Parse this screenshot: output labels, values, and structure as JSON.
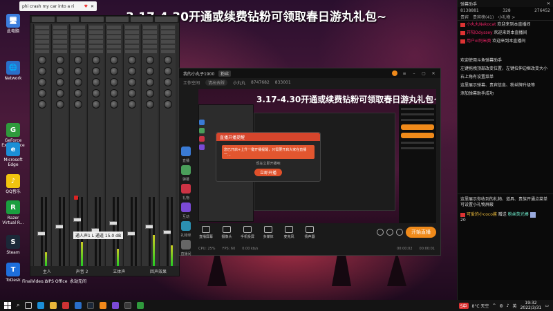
{
  "headline": "3.17-4.30开通或续费钻粉可领取春日游丸礼包~",
  "mini_tab": {
    "text": "phi crash my car into a ri",
    "heart_icon": "♥",
    "close_icon": "✕"
  },
  "desktop_icons": [
    {
      "label": "此电脑",
      "color": "#3b7ddd",
      "glyph": "🖥"
    },
    {
      "label": "Network",
      "color": "#2a6fc9",
      "glyph": "🌐"
    },
    {
      "label": "GeForce Experience",
      "color": "#2f9a3c",
      "glyph": "G"
    },
    {
      "label": "Microsoft Edge",
      "color": "#1b8fd6",
      "glyph": "e"
    },
    {
      "label": "QQ音乐",
      "color": "#f1c40f",
      "glyph": "♪"
    },
    {
      "label": "Razer Virtual R...",
      "color": "#1a9e3f",
      "glyph": "R"
    },
    {
      "label": "Steam",
      "color": "#1b2838",
      "glyph": "S"
    },
    {
      "label": "ToDesk",
      "color": "#1e6fdc",
      "glyph": "T"
    }
  ],
  "bottom_icons": [
    {
      "label": "FinalVideo..."
    },
    {
      "label": "WPS Office"
    },
    {
      "label": "永劫无间"
    }
  ],
  "mixer": {
    "label_box": "通人声1 L 通道  15.0 dB",
    "footer": [
      "主人",
      "声音 2",
      "立体声",
      "回声效果"
    ]
  },
  "stream_app": {
    "title": "我的小丸子1900",
    "tag": "粉丝",
    "sub_left": "工作空间",
    "sub_mid": "请出去踩",
    "sub_right": "小丸丸",
    "viewers": "8747682",
    "fans": "833001",
    "side_tools": [
      {
        "label": "直播",
        "color": "#3a7bd5"
      },
      {
        "label": "弹幕",
        "color": "#4a9f5a"
      },
      {
        "label": "礼物",
        "color": "#c34"
      },
      {
        "label": "互动",
        "color": "#7a4ad5"
      },
      {
        "label": "礼物单",
        "color": "#2b8fb0"
      },
      {
        "label": "直播间",
        "color": "#666"
      }
    ],
    "controls": [
      "直播屏幕",
      "摄像头",
      "手机投屏",
      "多媒体",
      "麦克风",
      "扬声器"
    ],
    "go_live": "开始直播",
    "status": {
      "bitrate": "CPU: 25%",
      "fps": "FPS: 60",
      "net": "0.00 kb/s",
      "time1": "00:00:02",
      "time2": "00:00:01"
    }
  },
  "popup": {
    "title": "直播开播提醒",
    "body": "您已开启+上升一键开播提醒，只需要开启大家在直播一...",
    "sub": "现在立即开播吧",
    "button": "立即开播"
  },
  "chat": {
    "header": "弹幕助手",
    "stats": [
      "8138881",
      "328",
      "276452"
    ],
    "tabs": [
      "贵宾",
      "贵宾榜(41)",
      "小礼物 >"
    ],
    "messages": [
      {
        "user": "小丸丸Nekocat",
        "text": "欢迎来到本直播间"
      },
      {
        "user": "开阳Odyssey",
        "text": "欢迎来到本直播间"
      },
      {
        "user": "用户ol阿米奥",
        "text": "欢迎来到本直播间"
      }
    ],
    "info": [
      "欢迎使用斗鱼弹幕助手",
      "左键拖拽顶部改变位置，左键拉伸边框改变大小",
      "右上角有设置菜单",
      "这里展示弹幕、贵宾信息、粉丝牌升级等",
      "添加弹幕助手成功"
    ],
    "gift_info": "这里展示你收到的礼物、道具、贵族开通点菜单可设置小礼物屏蔽",
    "gift": {
      "user": "可爱的小coco酱",
      "action": "赠送",
      "item": "粉丝荧光棒",
      "count": "20"
    }
  },
  "taskbar": {
    "ime": "S中",
    "weather": "8°C 天空",
    "time": "19:32",
    "date": "2022/3/31",
    "lang": "英"
  }
}
